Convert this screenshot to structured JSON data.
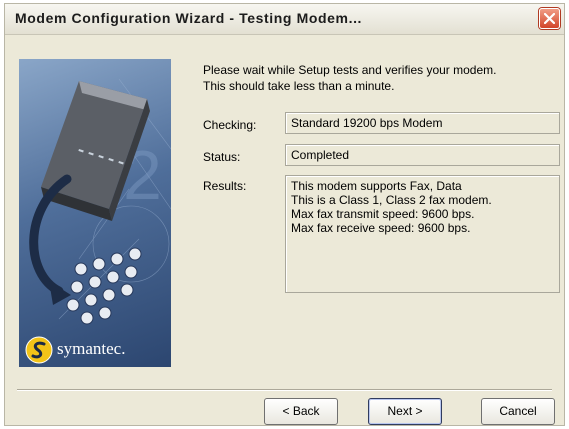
{
  "window": {
    "title": "Modem Configuration Wizard - Testing Modem..."
  },
  "branding": {
    "logo_text": "symantec."
  },
  "intro": {
    "line1": "Please wait while Setup tests and verifies your modem.",
    "line2": "This should take less than a minute."
  },
  "checking": {
    "label": "Checking:",
    "value": "Standard 19200 bps Modem"
  },
  "status": {
    "label": "Status:",
    "value": "Completed"
  },
  "results": {
    "label": "Results:",
    "lines": [
      "This modem supports Fax, Data",
      "This is a Class 1, Class 2 fax modem.",
      "Max fax transmit speed:  9600 bps.",
      "Max fax receive speed:  9600 bps."
    ]
  },
  "buttons": {
    "back": "< Back",
    "next": "Next >",
    "cancel": "Cancel"
  },
  "colors": {
    "dialog_bg": "#ece9d8",
    "close_button": "#d2452a"
  }
}
